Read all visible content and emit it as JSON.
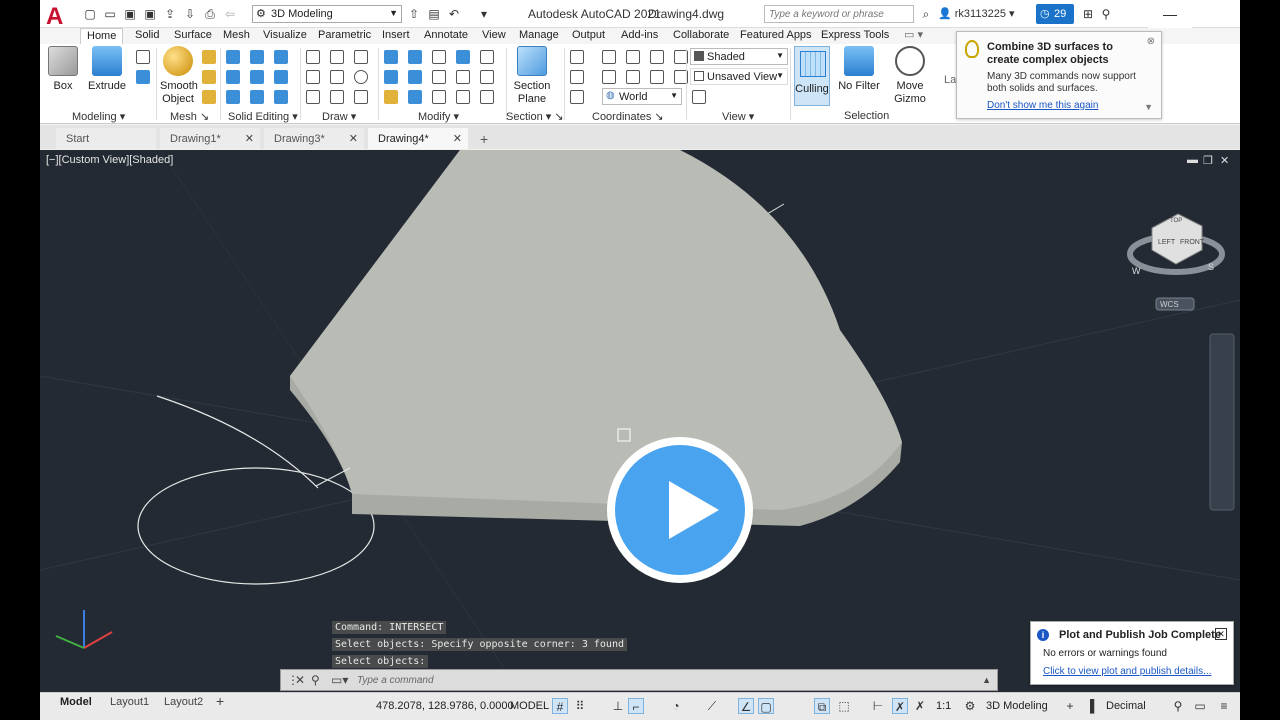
{
  "titlebar": {
    "workspace": "3D Modeling",
    "app_title": "Autodesk AutoCAD 2021",
    "document": "Drawing4.dwg",
    "search_placeholder": "Type a keyword or phrase",
    "user": "rk3113225",
    "badge_count": "29"
  },
  "ribbon": {
    "tabs": [
      "Home",
      "Solid",
      "Surface",
      "Mesh",
      "Visualize",
      "Parametric",
      "Insert",
      "Annotate",
      "View",
      "Manage",
      "Output",
      "Add-ins",
      "Collaborate",
      "Featured Apps",
      "Express Tools"
    ],
    "buttons": {
      "box": "Box",
      "extrude": "Extrude",
      "smooth": "Smooth",
      "smooth2": "Object",
      "section": "Section",
      "section2": "Plane",
      "culling": "Culling",
      "nofilter": "No Filter",
      "move": "Move",
      "move2": "Gizmo",
      "layers": "Layers"
    },
    "panels": [
      "Modeling",
      "Mesh",
      "Solid Editing",
      "Draw",
      "Modify",
      "Section",
      "Coordinates",
      "View",
      "Selection"
    ],
    "visual_style": "Shaded",
    "view_name": "Unsaved View",
    "ucs": "World"
  },
  "tip": {
    "title": "Combine 3D surfaces to create complex objects",
    "body": "Many 3D commands now support both solids and surfaces.",
    "link": "Don't show me this again"
  },
  "filetabs": [
    "Start",
    "Drawing1*",
    "Drawing3*",
    "Drawing4*"
  ],
  "viewport": {
    "label": "[−][Custom View][Shaded]",
    "wcs": "WCS",
    "cube_top": "TOP",
    "cube_left": "LEFT",
    "cube_front": "FRONT",
    "compass_w": "W",
    "compass_s": "S"
  },
  "command": {
    "history": [
      "Command: INTERSECT",
      "Select objects: Specify opposite corner: 3 found",
      "Select objects:"
    ],
    "placeholder": "Type a command"
  },
  "plot_notice": {
    "title": "Plot and Publish Job Complete",
    "body": "No errors or warnings found",
    "link": "Click to view plot and publish details..."
  },
  "status": {
    "tabs": [
      "Model",
      "Layout1",
      "Layout2"
    ],
    "coords": "478.2078, 128.9786, 0.0000",
    "model": "MODEL",
    "scale": "1:1",
    "workspace": "3D Modeling",
    "units": "Decimal"
  }
}
